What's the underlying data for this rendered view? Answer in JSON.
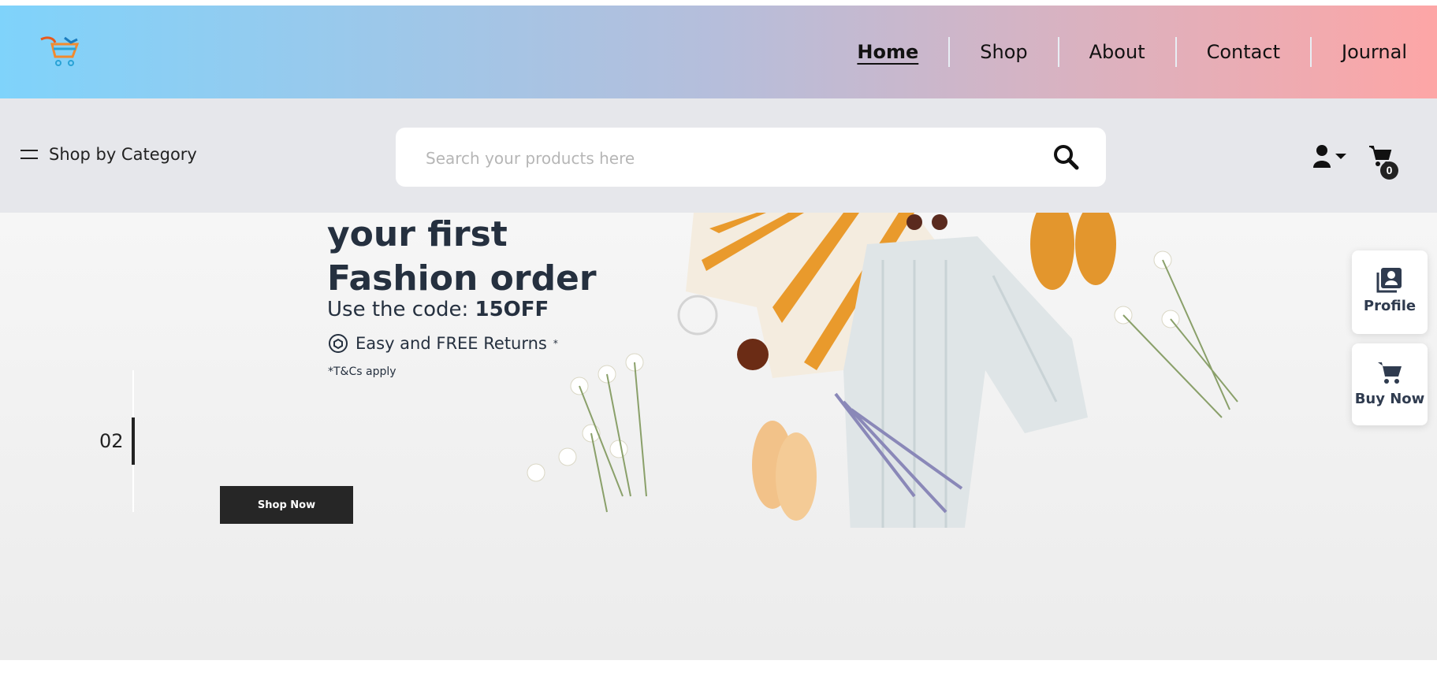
{
  "header": {
    "logo_icon": "cart-logo-icon",
    "nav": [
      {
        "label": "Home",
        "active": true
      },
      {
        "label": "Shop",
        "active": false
      },
      {
        "label": "About",
        "active": false
      },
      {
        "label": "Contact",
        "active": false
      },
      {
        "label": "Journal",
        "active": false
      }
    ],
    "gradient": [
      "#7fd3fb",
      "#b6bedb",
      "#fda6a6"
    ]
  },
  "subbar": {
    "category_label": "Shop by Category",
    "search_placeholder": "Search your products here",
    "search_value": "",
    "cart_count": "0"
  },
  "hero": {
    "title_line1": "your first",
    "title_line2": "Fashion order",
    "code_prefix": "Use the code: ",
    "code": "15OFF",
    "returns": "Easy and FREE Returns",
    "returns_mark": "*",
    "terms": "*T&Cs apply",
    "slide_number": "02",
    "cta_label": "Shop Now"
  },
  "floating": {
    "profile_label": "Profile",
    "buy_label": "Buy Now"
  },
  "colors": {
    "accent_dark": "#262626",
    "hero_text": "#25303f",
    "subbar_bg": "#e6e7eb"
  }
}
